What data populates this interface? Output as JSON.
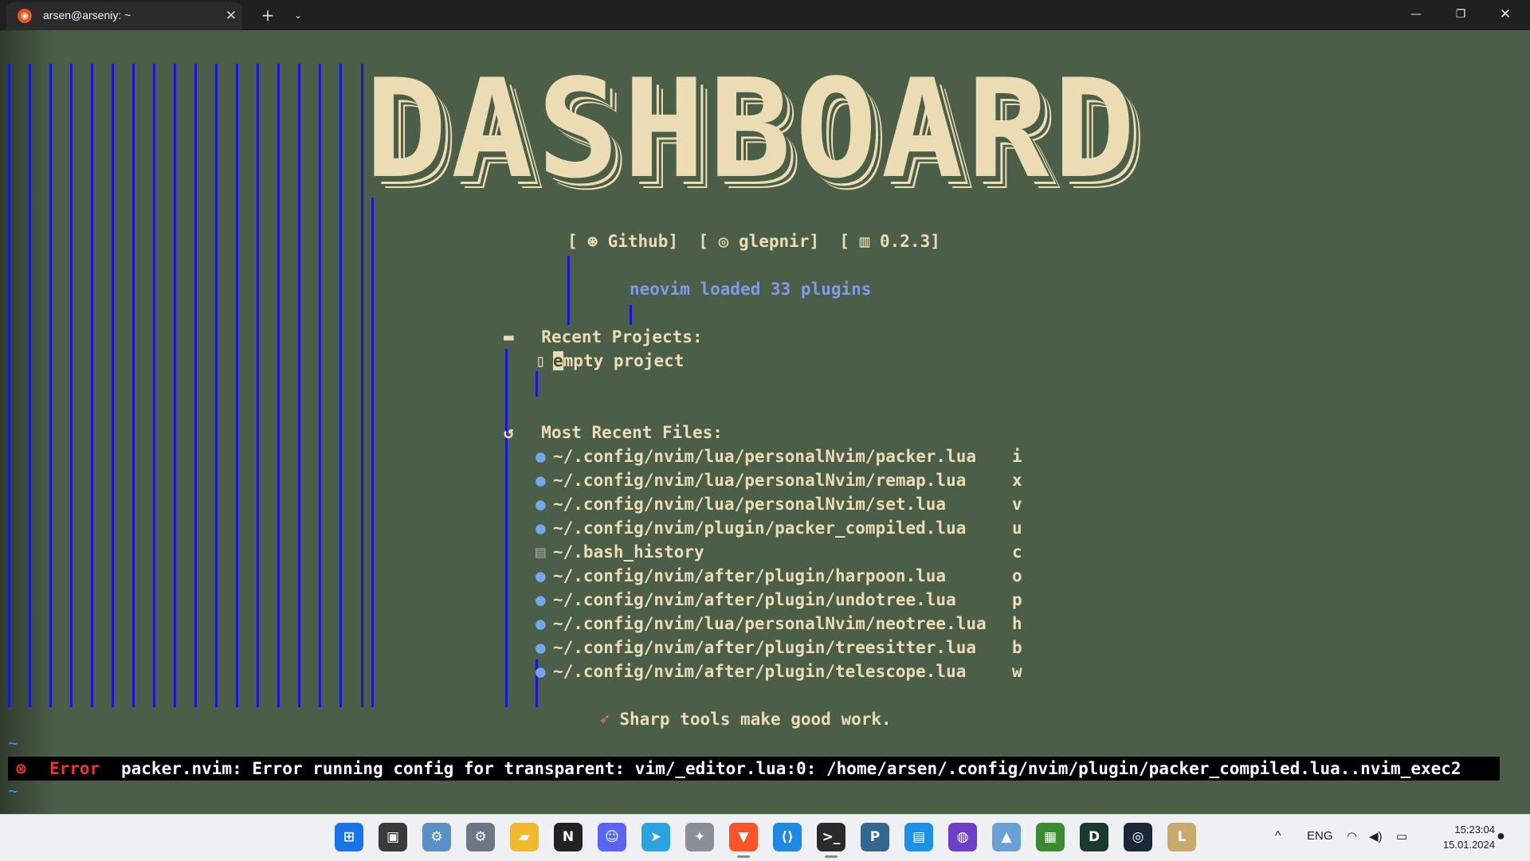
{
  "window": {
    "tab_title": "arsen@arseniy: ~",
    "tab_icon": "ubuntu-icon",
    "close_tab": "✕",
    "new_tab": "+",
    "tab_dropdown": "⌄",
    "minimize": "—",
    "maximize": "❐",
    "close": "✕"
  },
  "dashboard": {
    "banner": "DASHBOARD",
    "links": {
      "github_icon": "github-icon",
      "github": "Github",
      "user_icon": "user-icon",
      "user": "glepnir",
      "version_icon": "version-icon",
      "version": "0.2.3"
    },
    "loaded": "neovim loaded 33 plugins",
    "recent_projects": {
      "header": "Recent Projects:",
      "icon": "folder-icon",
      "items": [
        "empty project"
      ],
      "cursor_char": "e",
      "item_rest": "mpty project"
    },
    "recent_files": {
      "header": "Most Recent Files:",
      "icon": "history-icon",
      "items": [
        {
          "path": "~/.config/nvim/lua/personalNvim/packer.lua",
          "key": "i",
          "icon": "lua-icon"
        },
        {
          "path": "~/.config/nvim/lua/personalNvim/remap.lua",
          "key": "x",
          "icon": "lua-icon"
        },
        {
          "path": "~/.config/nvim/lua/personalNvim/set.lua",
          "key": "v",
          "icon": "lua-icon"
        },
        {
          "path": "~/.config/nvim/plugin/packer_compiled.lua",
          "key": "u",
          "icon": "lua-icon"
        },
        {
          "path": "~/.bash_history",
          "key": "c",
          "icon": "file-icon"
        },
        {
          "path": "~/.config/nvim/after/plugin/harpoon.lua",
          "key": "o",
          "icon": "lua-icon"
        },
        {
          "path": "~/.config/nvim/after/plugin/undotree.lua",
          "key": "p",
          "icon": "lua-icon"
        },
        {
          "path": "~/.config/nvim/lua/personalNvim/neotree.lua",
          "key": "h",
          "icon": "lua-icon"
        },
        {
          "path": "~/.config/nvim/after/plugin/treesitter.lua",
          "key": "b",
          "icon": "lua-icon"
        },
        {
          "path": "~/.config/nvim/after/plugin/telescope.lua",
          "key": "w",
          "icon": "lua-icon"
        }
      ]
    },
    "footer": "Sharp tools make good work.",
    "footer_icon": "rocket-icon",
    "tilde": "~"
  },
  "error": {
    "label": "Error",
    "message": "packer.nvim: Error running config for transparent: vim/_editor.lua:0: /home/arsen/.config/nvim/plugin/packer_compiled.lua..nvim_exec2"
  },
  "taskbar": {
    "apps": [
      {
        "name": "start-icon",
        "active": false
      },
      {
        "name": "task-view-icon",
        "active": false
      },
      {
        "name": "control-panel-icon",
        "active": false
      },
      {
        "name": "settings-icon",
        "active": false
      },
      {
        "name": "file-explorer-icon",
        "active": false
      },
      {
        "name": "notion-icon",
        "active": false
      },
      {
        "name": "discord-icon",
        "active": false
      },
      {
        "name": "telegram-icon",
        "active": false
      },
      {
        "name": "app-icon",
        "active": false
      },
      {
        "name": "brave-icon",
        "active": true
      },
      {
        "name": "vscode-icon",
        "active": false
      },
      {
        "name": "terminal-icon",
        "active": true
      },
      {
        "name": "postgresql-icon",
        "active": false
      },
      {
        "name": "docker-icon",
        "active": false
      },
      {
        "name": "github-desktop-icon",
        "active": false
      },
      {
        "name": "resource-monitor-icon",
        "active": false
      },
      {
        "name": "minecraft-icon",
        "active": false
      },
      {
        "name": "dota-icon",
        "active": false
      },
      {
        "name": "steam-icon",
        "active": false
      },
      {
        "name": "league-of-legends-icon",
        "active": false
      }
    ],
    "tray": {
      "language": "ENG",
      "time": "15:23:04",
      "date": "15.01.2024"
    }
  }
}
